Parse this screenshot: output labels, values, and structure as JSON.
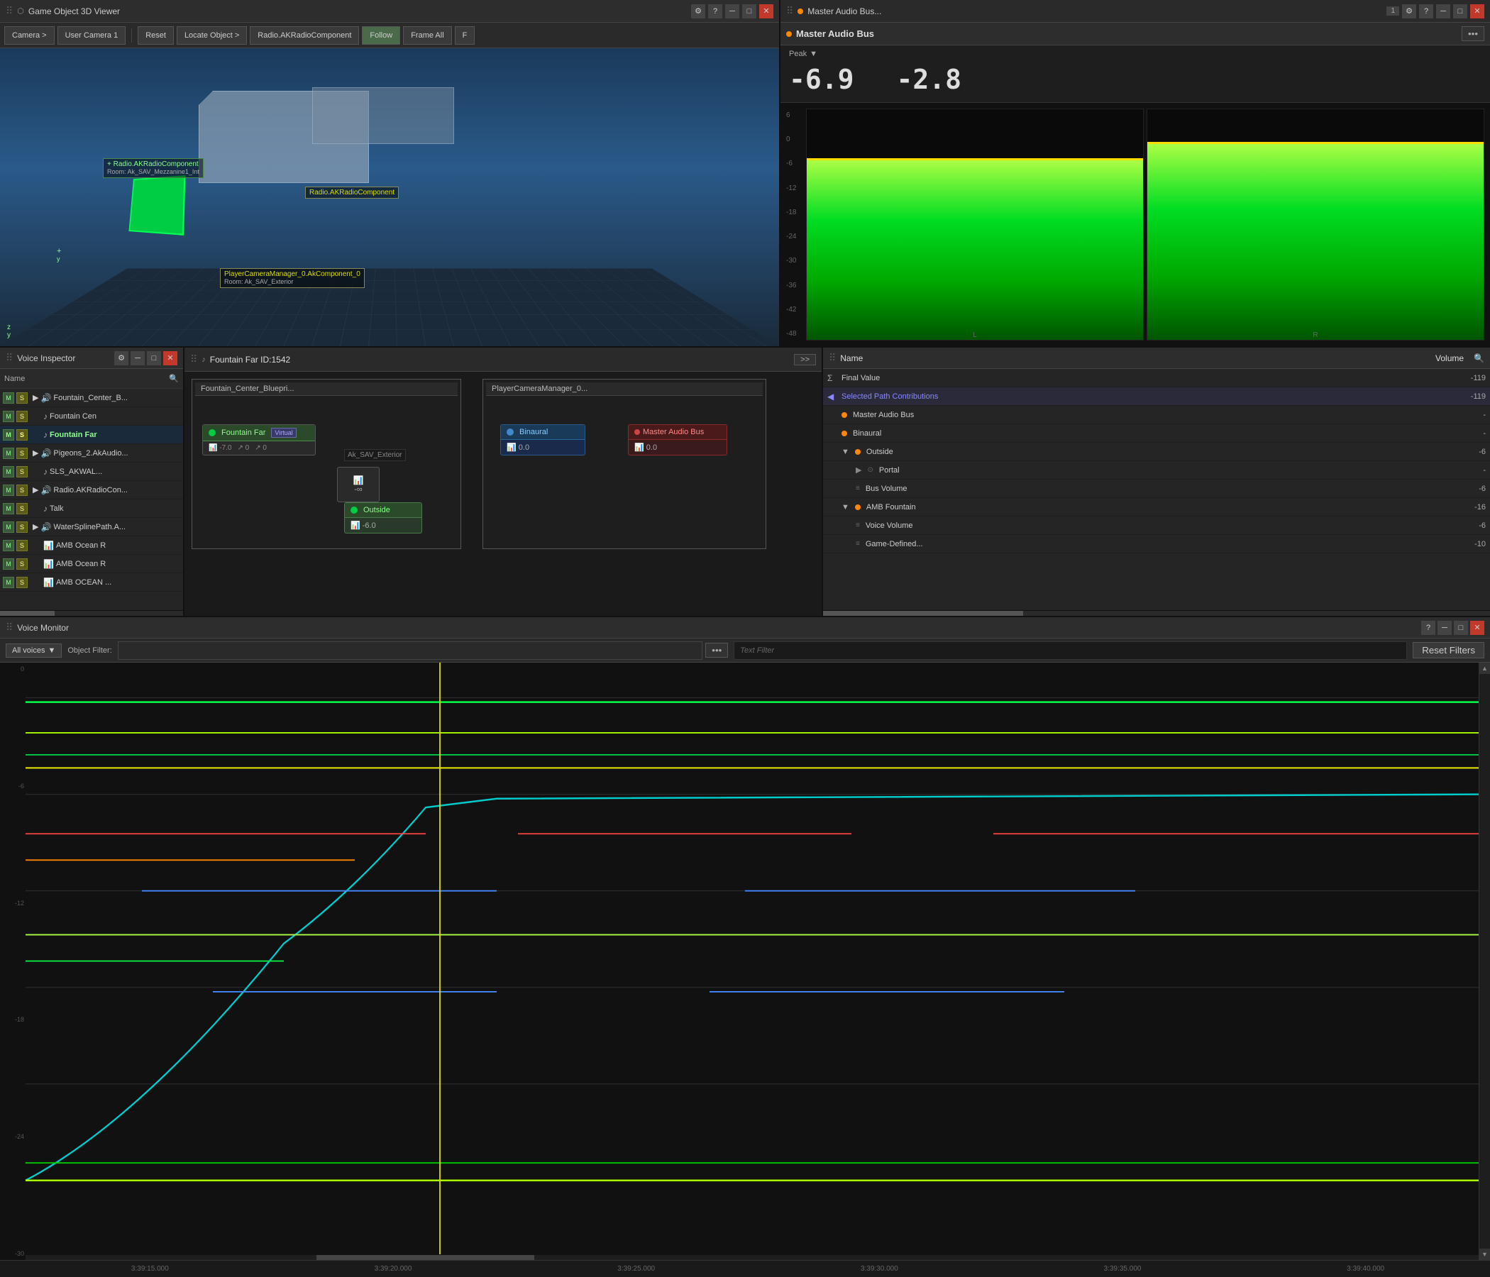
{
  "window1": {
    "title": "Game Object 3D Viewer",
    "icon": "●"
  },
  "window2": {
    "title": "Master Audio Bus...",
    "tab_title": "Master Audio Bus"
  },
  "viewer": {
    "toolbar": {
      "camera_btn": "Camera >",
      "user_camera": "User Camera 1",
      "reset_btn": "Reset",
      "locate_btn": "Locate Object >",
      "component_btn": "Radio.AKRadioComponent",
      "follow_btn": "Follow",
      "frame_btn": "Frame All"
    },
    "labels": {
      "radio_room": "Radio.AKRadioComponent\nRoom: Ak_SAV_Mezzanine1_Int",
      "radio_component": "Radio.AKRadioComponent",
      "camera": "PlayerCameraManager_0.AkComponent_0\nRoom: Ak_SAV_Exterior"
    }
  },
  "audio_bus": {
    "title": "Master Audio Bus",
    "peak_label": "Peak",
    "peak_left": "-6.9",
    "peak_right": "-2.8",
    "scale": [
      "6",
      "0",
      "-6",
      "-12",
      "-18",
      "-24",
      "-30",
      "-36",
      "-42",
      "-48"
    ],
    "labels": {
      "L": "L",
      "R": "R"
    }
  },
  "voice_inspector": {
    "title": "Voice Inspector",
    "col_name": "Name",
    "items": [
      {
        "m": "M",
        "s": "S",
        "indent": 1,
        "icon": "🔊",
        "name": "Fountain_Center_B...",
        "selected": false
      },
      {
        "m": "M",
        "s": "S",
        "indent": 2,
        "icon": "♪",
        "name": "Fountain Cen",
        "selected": false
      },
      {
        "m": "M",
        "s": "S",
        "indent": 2,
        "icon": "♪",
        "name": "Fountain Far",
        "selected": true
      },
      {
        "m": "M",
        "s": "S",
        "indent": 1,
        "icon": "🔊",
        "name": "Pigeons_2.AkAudio...",
        "selected": false
      },
      {
        "m": "M",
        "s": "S",
        "indent": 2,
        "icon": "♪",
        "name": "SLS_AKWAL...",
        "selected": false
      },
      {
        "m": "M",
        "s": "S",
        "indent": 1,
        "icon": "🔊",
        "name": "Radio.AKRadioCon...",
        "selected": false
      },
      {
        "m": "M",
        "s": "S",
        "indent": 2,
        "icon": "♪",
        "name": "Talk",
        "selected": false
      },
      {
        "m": "M",
        "s": "S",
        "indent": 1,
        "icon": "🔊",
        "name": "WaterSplinePath.A...",
        "selected": false
      },
      {
        "m": "M",
        "s": "S",
        "indent": 2,
        "icon": "📊",
        "name": "AMB Ocean R",
        "selected": false
      },
      {
        "m": "M",
        "s": "S",
        "indent": 2,
        "icon": "📊",
        "name": "AMB Ocean R",
        "selected": false
      },
      {
        "m": "M",
        "s": "S",
        "indent": 2,
        "icon": "📊",
        "name": "AMB OCEAN ...",
        "selected": false
      }
    ]
  },
  "node_graph": {
    "title": "Fountain Far  ID:1542",
    "containers": {
      "left": "Fountain_Center_Bluepri...",
      "right": "PlayerCameraManager_0..."
    },
    "nodes": {
      "fountain_far": {
        "label": "Fountain Far",
        "tag": "Virtual",
        "val1": "-7.0",
        "val2": "0",
        "val3": "0"
      },
      "minus_inf": "-∞",
      "ak_sav": "Ak_SAV_Exterior",
      "outside": {
        "label": "Outside",
        "val": "-6.0"
      },
      "binaural": {
        "label": "Binaural",
        "val": "0.0"
      },
      "master_audio_bus": {
        "label": "Master Audio Bus",
        "val": "0.0"
      }
    }
  },
  "path_contributions": {
    "title": "Selected Path Contributions",
    "col_name": "Name",
    "col_volume": "Volume",
    "rows": [
      {
        "depth": 0,
        "icon": "Σ",
        "name": "Final Value",
        "vol": "-119",
        "type": "sigma"
      },
      {
        "depth": 0,
        "icon": "◀",
        "name": "Selected Path Contributions",
        "vol": "-119",
        "type": "section"
      },
      {
        "depth": 1,
        "icon": "≡",
        "name": "Master Audio Bus",
        "vol": "-",
        "type": "item"
      },
      {
        "depth": 1,
        "icon": "≡",
        "name": "Binaural",
        "vol": "-",
        "type": "item"
      },
      {
        "depth": 1,
        "icon": "▼",
        "name": "Outside",
        "vol": "-6",
        "type": "folder"
      },
      {
        "depth": 2,
        "icon": "▶",
        "name": "Portal",
        "vol": "-",
        "type": "sub"
      },
      {
        "depth": 2,
        "icon": "≡",
        "name": "Bus Volume",
        "vol": "-6",
        "type": "item"
      },
      {
        "depth": 1,
        "icon": "▼",
        "name": "AMB Fountain",
        "vol": "-16",
        "type": "folder"
      },
      {
        "depth": 2,
        "icon": "≡",
        "name": "Voice Volume",
        "vol": "-6",
        "type": "item"
      },
      {
        "depth": 2,
        "icon": "≡",
        "name": "Game-Defined...",
        "vol": "-10",
        "type": "item"
      }
    ]
  },
  "voice_monitor": {
    "title": "Voice Monitor",
    "all_voices": "All voices",
    "object_filter_label": "Object Filter:",
    "text_filter_placeholder": "Text Filter",
    "reset_filters": "Reset Filters",
    "time_labels": [
      "3:39:15.000",
      "3:39:20.000",
      "3:39:25.000",
      "3:39:30.000",
      "3:39:35.000",
      "3:39:40.000"
    ],
    "y_labels": [
      "0",
      "-6",
      "-12",
      "-18",
      "-24",
      "-30"
    ]
  }
}
